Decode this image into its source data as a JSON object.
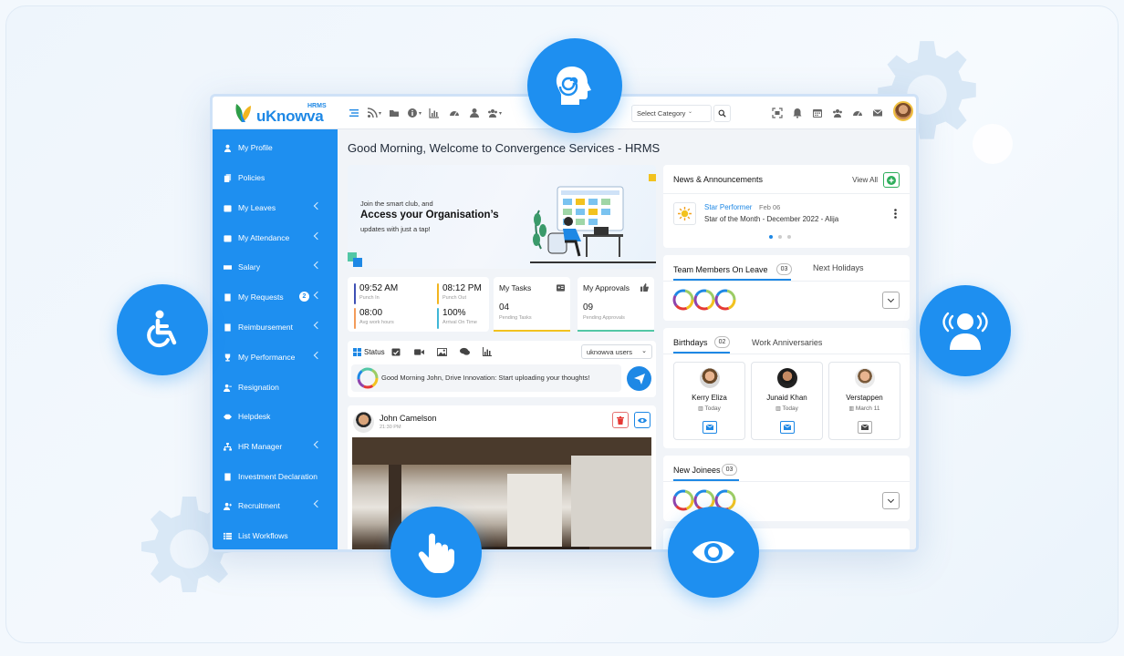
{
  "app": {
    "logo_text": "uKnowva",
    "logo_sup": "HRMS",
    "greeting": "Good Morning, Welcome to Convergence Services - HRMS"
  },
  "topbar": {
    "category_placeholder": "Select Category"
  },
  "sidebar": {
    "items": [
      {
        "label": "My Profile",
        "icon": "user-icon",
        "chevron": false
      },
      {
        "label": "Policies",
        "icon": "files-icon",
        "chevron": false
      },
      {
        "label": "My Leaves",
        "icon": "calendar-icon",
        "chevron": true
      },
      {
        "label": "My Attendance",
        "icon": "calendar-check-icon",
        "chevron": true
      },
      {
        "label": "Salary",
        "icon": "money-icon",
        "chevron": true
      },
      {
        "label": "My Requests",
        "icon": "document-icon",
        "chevron": true,
        "badge": "2"
      },
      {
        "label": "Reimbursement",
        "icon": "receipt-icon",
        "chevron": true
      },
      {
        "label": "My Performance",
        "icon": "trophy-icon",
        "chevron": true
      },
      {
        "label": "Resignation",
        "icon": "user-minus-icon",
        "chevron": false
      },
      {
        "label": "Helpdesk",
        "icon": "handshake-icon",
        "chevron": false
      },
      {
        "label": "HR Manager",
        "icon": "sitemap-icon",
        "chevron": true
      },
      {
        "label": "Investment Declaration",
        "icon": "file-icon",
        "chevron": false
      },
      {
        "label": "Recruitment",
        "icon": "user-plus-icon",
        "chevron": true
      },
      {
        "label": "List Workflows",
        "icon": "list-icon",
        "chevron": false
      }
    ]
  },
  "banner": {
    "line1": "Join the smart club, and",
    "headline": "Access your Organisation’s",
    "line2": "updates with  just a tap!"
  },
  "stats": {
    "punch_in": {
      "value": "09:52 AM",
      "label": "Punch In",
      "color": "#3f51b5"
    },
    "punch_out": {
      "value": "08:12 PM",
      "label": "Punch Out",
      "color": "#f2b51f"
    },
    "avg_hours": {
      "value": "08:00",
      "label": "Avg work hours",
      "color": "#f39c5a"
    },
    "arrival": {
      "value": "100%",
      "label": "Arrival On Time",
      "color": "#3fb7d7"
    }
  },
  "tasks": {
    "title": "My Tasks",
    "value": "04",
    "label": "Pending Tasks",
    "color": "#f2c21f"
  },
  "approvals": {
    "title": "My Approvals",
    "value": "09",
    "label": "Pending Approvals",
    "color": "#52c7a6"
  },
  "status": {
    "tab_label": "Status",
    "users_select": "uknowva users",
    "placeholder": "Good Morning John, Drive Innovation: Start uploading your thoughts!"
  },
  "post": {
    "author": "John Camelson",
    "time": "21:30 PM"
  },
  "news": {
    "title": "News & Announcements",
    "view_all": "View All",
    "item_title": "Star Performer",
    "item_date": "Feb 06",
    "item_sub": "Star of the Month - December 2022 - Alija"
  },
  "leave": {
    "tab1": "Team Members On Leave",
    "tab1_count": "03",
    "tab2": "Next Holidays"
  },
  "birthdays": {
    "tab1": "Birthdays",
    "tab1_count": "02",
    "tab2": "Work Anniversaries",
    "people": [
      {
        "name": "Kerry Eliza",
        "date": "Today"
      },
      {
        "name": "Junaid Khan",
        "date": "Today"
      },
      {
        "name": "Verstappen",
        "date": "March 11"
      }
    ]
  },
  "joinees": {
    "title": "New Joinees",
    "count": "03"
  },
  "colors": {
    "primary": "#1e8ff0",
    "sidebar": "#1e8ff0",
    "accent_green": "#2eae5b"
  }
}
